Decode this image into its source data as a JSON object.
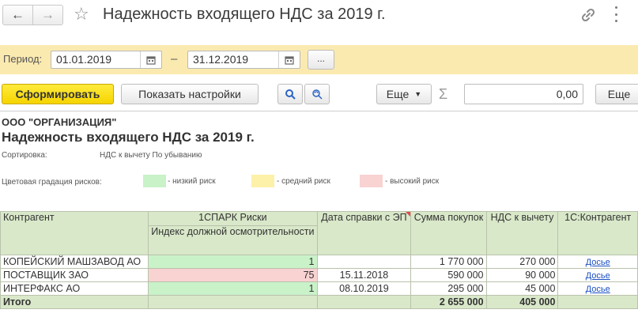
{
  "window": {
    "title": "Надежность входящего НДС за 2019 г."
  },
  "icons": [
    "arrow-left-icon",
    "arrow-right-icon",
    "star-icon",
    "link-icon",
    "more-vertical-icon",
    "calendar-icon",
    "search-icon",
    "search-refresh-icon",
    "sigma-icon"
  ],
  "period": {
    "label": "Период:",
    "from": "01.01.2019",
    "to": "31.12.2019",
    "dash": "–",
    "more_label": "..."
  },
  "toolbar": {
    "generate_label": "Сформировать",
    "settings_label": "Показать настройки",
    "more_label": "Еще",
    "sigma": "Σ",
    "sum_value": "0,00",
    "more2_label": "Еще"
  },
  "report": {
    "org": "ООО \"ОРГАНИЗАЦИЯ\"",
    "title": "Надежность входящего НДС за 2019 г.",
    "sort_label": "Сортировка:",
    "sort_value": "НДС к вычету По убыванию",
    "legend_label": "Цветовая градация рисков:",
    "legend": [
      {
        "text": "- низкий риск",
        "color": "#c9f2c9"
      },
      {
        "text": "- средний риск",
        "color": "#fdf0a8"
      },
      {
        "text": "- высокий риск",
        "color": "#f9d2d2"
      }
    ],
    "columns": {
      "counterparty": "Контрагент",
      "spark": "1СПАРК Риски",
      "spark_sub": "Индекс должной осмотрительности",
      "cert_date": "Дата справки с ЭП",
      "purchases": "Сумма покупок",
      "vat": "НДС к вычету",
      "kontragent": "1С:Контрагент"
    },
    "rows": [
      {
        "name": "КОПЕЙСКИЙ МАШЗАВОД АО",
        "index": "1",
        "risk": "low",
        "date": "",
        "sum": "1 770 000",
        "vat": "270 000",
        "link": "Досье"
      },
      {
        "name": "ПОСТАВЩИК ЗАО",
        "index": "75",
        "risk": "high",
        "date": "15.11.2018",
        "sum": "590 000",
        "vat": "90 000",
        "link": "Досье"
      },
      {
        "name": "ИНТЕРФАКС АО",
        "index": "1",
        "risk": "low",
        "date": "08.10.2019",
        "sum": "295 000",
        "vat": "45 000",
        "link": "Досье"
      }
    ],
    "total": {
      "label": "Итого",
      "sum": "2 655 000",
      "vat": "405 000"
    },
    "risk_colors": {
      "low": "#c9f2c9",
      "medium": "#fdf0a8",
      "high": "#f9d2d2"
    }
  }
}
